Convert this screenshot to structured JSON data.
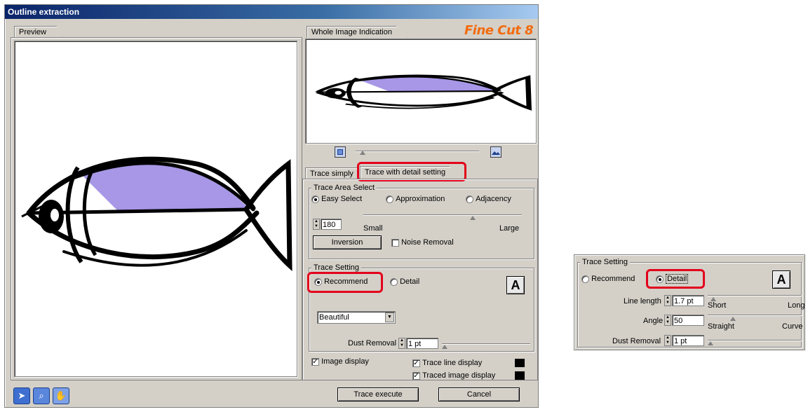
{
  "window": {
    "title": "Outline extraction"
  },
  "brand": {
    "logo": "Fine Cut 8",
    "logo_color": "#f26b0f",
    "logo_accent": "#1a3ca8"
  },
  "preview": {
    "tab_label": "Preview"
  },
  "whole_image": {
    "tab_label": "Whole Image Indication"
  },
  "zoom": {
    "left_icon": "zoom-out-icon",
    "right_icon": "zoom-fit-icon"
  },
  "tabs": [
    {
      "label": "Trace simply",
      "active": false
    },
    {
      "label": "Trace with detail setting",
      "active": true
    }
  ],
  "trace_area": {
    "title": "Trace Area Select",
    "options": [
      {
        "label": "Easy Select",
        "selected": true
      },
      {
        "label": "Approximation",
        "selected": false
      },
      {
        "label": "Adjacency",
        "selected": false
      }
    ],
    "value": "180",
    "slider_min_label": "Small",
    "slider_max_label": "Large",
    "inversion_label": "Inversion",
    "noise_removal_label": "Noise Removal",
    "noise_removal_checked": false
  },
  "trace_setting": {
    "title": "Trace Setting",
    "recommend_label": "Recommend",
    "detail_label": "Detail",
    "recommend_selected": true,
    "preset_value": "Beautiful",
    "dust_removal_label": "Dust Removal",
    "dust_removal_value": "1 pt",
    "icon": "A"
  },
  "display": {
    "image_display_label": "Image display",
    "image_display_checked": true,
    "trace_line_label": "Trace line display",
    "trace_line_checked": true,
    "traced_image_label": "Traced image display",
    "traced_image_checked": true,
    "swatch_color": "#000000"
  },
  "tools": [
    {
      "name": "arrow-tool-icon",
      "glyph": "➤"
    },
    {
      "name": "zoom-tool-icon",
      "glyph": "🔍"
    },
    {
      "name": "hand-tool-icon",
      "glyph": "✋"
    }
  ],
  "buttons": {
    "trace_execute": "Trace execute",
    "cancel": "Cancel"
  },
  "detail_panel": {
    "title": "Trace Setting",
    "recommend_label": "Recommend",
    "detail_label": "Detail",
    "detail_selected": true,
    "line_length_label": "Line length",
    "line_length_value": "1.7 pt",
    "line_length_min": "Short",
    "line_length_max": "Long",
    "angle_label": "Angle",
    "angle_value": "50",
    "angle_min": "Straight",
    "angle_max": "Curve",
    "dust_removal_label": "Dust Removal",
    "dust_removal_value": "1 pt",
    "icon": "A"
  },
  "highlight_color": "#e3001b",
  "fish_fill_color": "#a797e6"
}
